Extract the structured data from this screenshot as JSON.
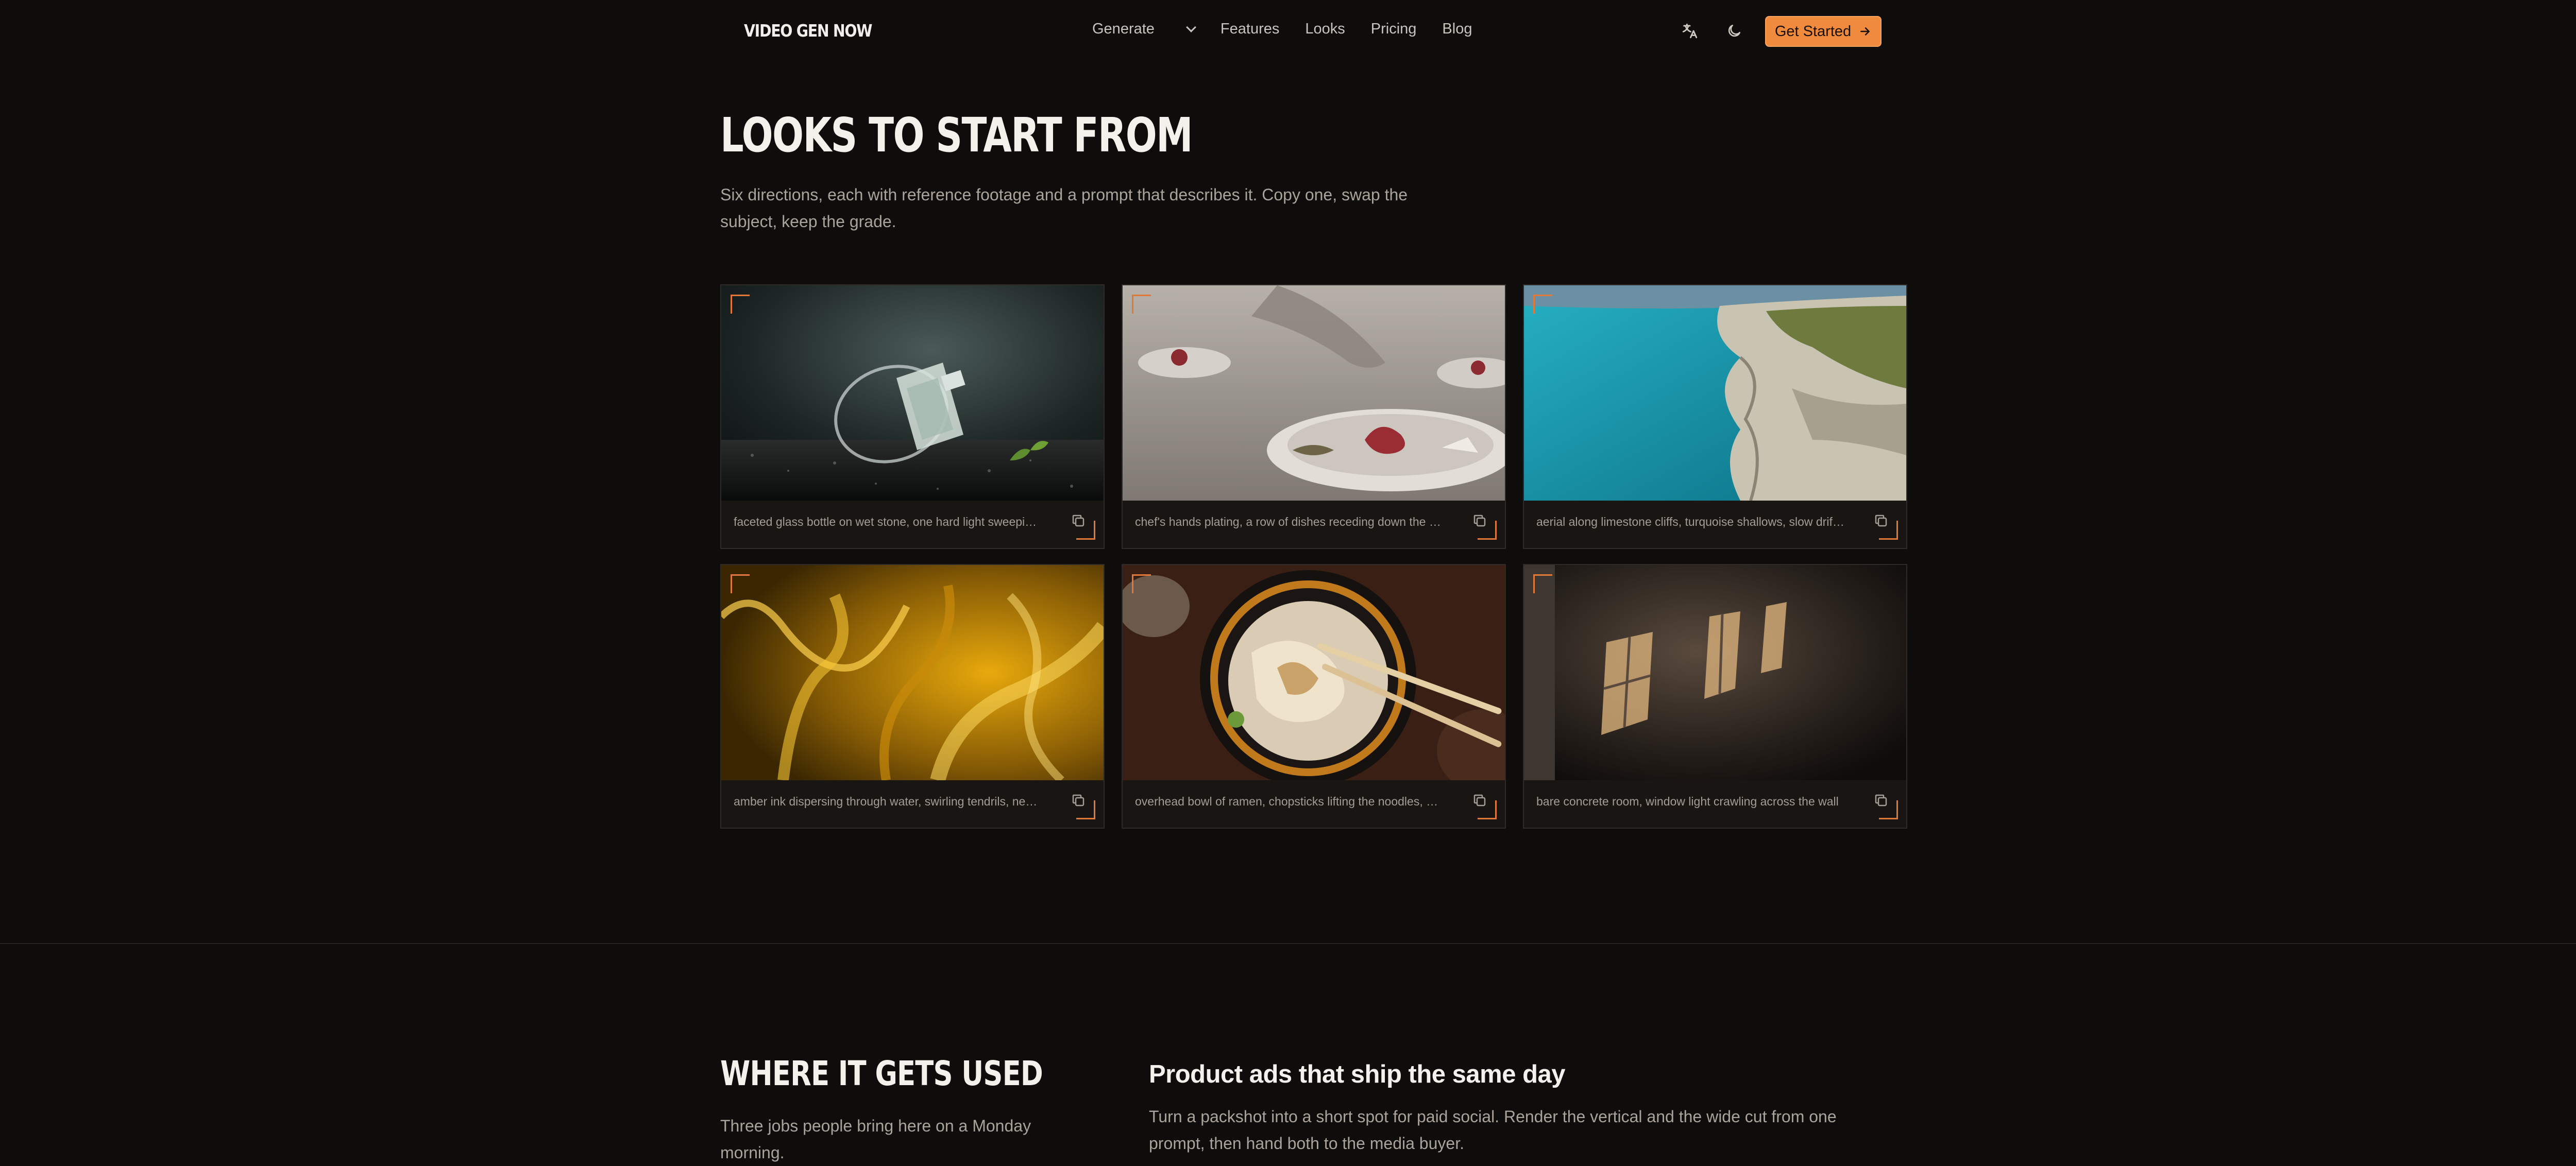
{
  "nav": {
    "logo": "VIDEO GEN NOW",
    "items": [
      "Generate",
      "Features",
      "Looks",
      "Pricing",
      "Blog"
    ],
    "cta": "Get Started"
  },
  "hero": {
    "title": "LOOKS TO START FROM",
    "subtitle": "Six directions, each with reference footage and a prompt that describes it. Copy one, swap the subject, keep the grade."
  },
  "looks": [
    {
      "caption": "faceted glass bottle on wet stone, one hard light sweeping across"
    },
    {
      "caption": "chef's hands plating, a row of dishes receding down the pass"
    },
    {
      "caption": "aerial along limestone cliffs, turquoise shallows, slow drift forward"
    },
    {
      "caption": "amber ink dispersing through water, swirling tendrils, near black"
    },
    {
      "caption": "overhead bowl of ramen, chopsticks lifting the noodles, warm steam"
    },
    {
      "caption": "bare concrete room, window light crawling across the wall"
    }
  ],
  "uses": {
    "title": "WHERE IT GETS USED",
    "subtitle": "Three jobs people bring here on a Monday morning.",
    "first_title": "Product ads that ship the same day",
    "first_body": "Turn a packshot into a short spot for paid social. Render the vertical and the wide cut from one prompt, then hand both to the media buyer."
  },
  "colors": {
    "accent": "#f08a3c",
    "background": "#0f0d0c"
  }
}
